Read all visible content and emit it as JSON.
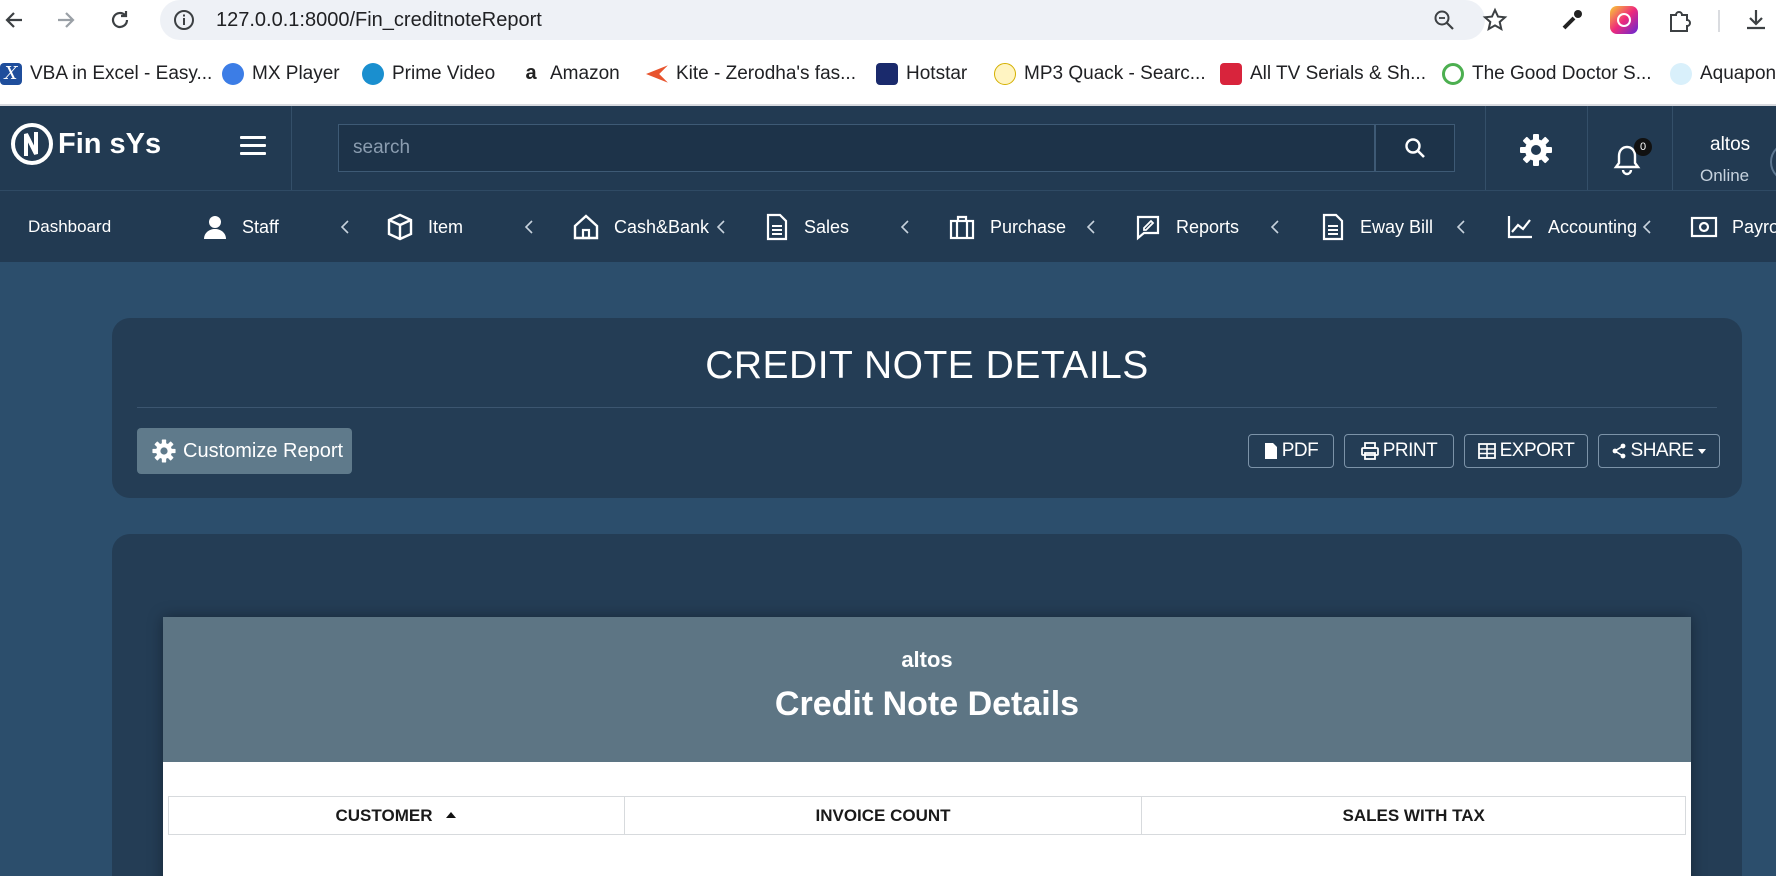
{
  "browser": {
    "url": "127.0.0.1:8000/Fin_creditnoteReport",
    "bookmarks": [
      {
        "label": "VBA in Excel - Easy...",
        "icon": "excel-x-icon",
        "color": "#1f4e9c"
      },
      {
        "label": "MX Player",
        "icon": "mx-player-icon",
        "color": "#3c7de6"
      },
      {
        "label": "Prime Video",
        "icon": "prime-video-icon",
        "color": "#1a8fcf"
      },
      {
        "label": "Amazon",
        "icon": "amazon-icon",
        "color": "#222222"
      },
      {
        "label": "Kite - Zerodha's fas...",
        "icon": "kite-icon",
        "color": "#e8542e"
      },
      {
        "label": "Hotstar",
        "icon": "hotstar-icon",
        "color": "#1a2a6c"
      },
      {
        "label": "MP3 Quack - Searc...",
        "icon": "duck-icon",
        "color": "#f0c419"
      },
      {
        "label": "All TV Serials & Sh...",
        "icon": "tv-serials-icon",
        "color": "#d8243c"
      },
      {
        "label": "The Good Doctor S...",
        "icon": "play-circle-icon",
        "color": "#4caf50"
      },
      {
        "label": "Aquapon",
        "icon": "aquapon-icon",
        "color": "#2a9fd6"
      }
    ]
  },
  "header": {
    "brand": "Fin sYs",
    "search_placeholder": "search",
    "notification_count": "0",
    "user_name": "altos",
    "user_status": "Online"
  },
  "menu": {
    "dashboard": "Dashboard",
    "items": [
      {
        "label": "Staff",
        "icon": "person-icon"
      },
      {
        "label": "Item",
        "icon": "box-icon"
      },
      {
        "label": "Cash&Bank",
        "icon": "home-icon"
      },
      {
        "label": "Sales",
        "icon": "document-icon"
      },
      {
        "label": "Purchase",
        "icon": "briefcase-icon"
      },
      {
        "label": "Reports",
        "icon": "report-edit-icon"
      },
      {
        "label": "Eway Bill",
        "icon": "document-icon"
      },
      {
        "label": "Accounting",
        "icon": "line-chart-icon"
      },
      {
        "label": "Payro",
        "icon": "cash-icon"
      }
    ]
  },
  "toolbar": {
    "title": "CREDIT NOTE DETAILS",
    "customize_label": "Customize Report",
    "pdf_label": "PDF",
    "print_label": "PRINT",
    "export_label": "EXPORT",
    "share_label": "SHARE"
  },
  "report": {
    "company": "altos",
    "title": "Credit Note Details",
    "columns": [
      "CUSTOMER",
      "INVOICE COUNT",
      "SALES WITH TAX"
    ]
  },
  "colors": {
    "page_bg": "#2c4e6c",
    "header_bg": "#223a52",
    "card_bg": "#243d55",
    "report_header": "#5d7584",
    "customize_button": "#5f7a8b"
  }
}
